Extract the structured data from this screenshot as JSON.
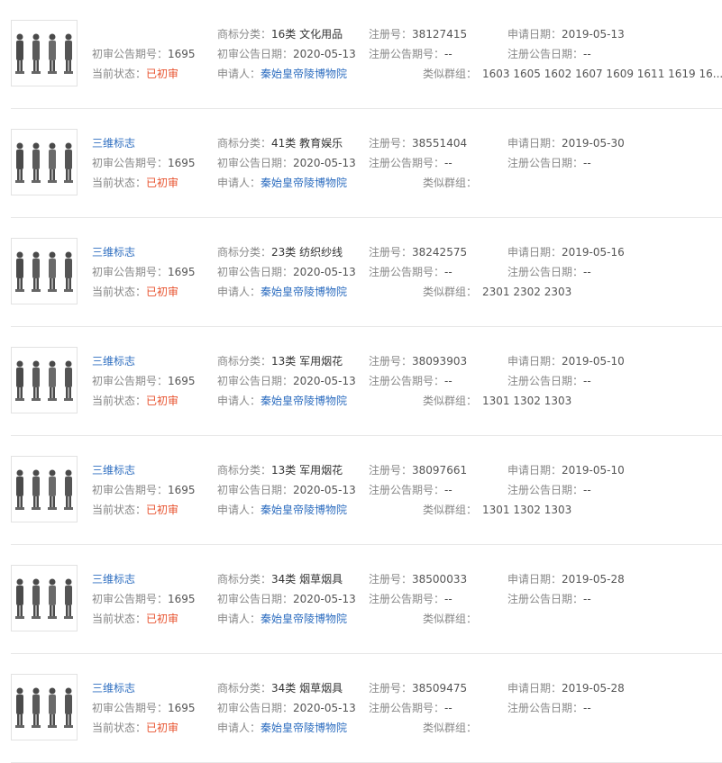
{
  "labels": {
    "announce_no": "初审公告期号：",
    "status": "当前状态：",
    "category": "商标分类：",
    "announce_date": "初审公告日期：",
    "applicant": "申请人：",
    "reg_no": "注册号：",
    "reg_announce_no": "注册公告期号：",
    "similar_group": "类似群组：",
    "apply_date": "申请日期：",
    "reg_announce_date": "注册公告日期："
  },
  "records": [
    {
      "title": "",
      "announce_no": "1695",
      "status": "已初审",
      "category": "16类 文化用品",
      "announce_date": "2020-05-13",
      "applicant": "秦始皇帝陵博物院",
      "reg_no": "38127415",
      "reg_announce_no": "--",
      "similar_group": "1603 1605 1602 1607 1609 1611 1619 16...",
      "apply_date": "2019-05-13",
      "reg_announce_date": "--"
    },
    {
      "title": "三维标志",
      "announce_no": "1695",
      "status": "已初审",
      "category": "41类 教育娱乐",
      "announce_date": "2020-05-13",
      "applicant": "秦始皇帝陵博物院",
      "reg_no": "38551404",
      "reg_announce_no": "--",
      "similar_group": "",
      "apply_date": "2019-05-30",
      "reg_announce_date": "--"
    },
    {
      "title": "三维标志",
      "announce_no": "1695",
      "status": "已初审",
      "category": "23类 纺织纱线",
      "announce_date": "2020-05-13",
      "applicant": "秦始皇帝陵博物院",
      "reg_no": "38242575",
      "reg_announce_no": "--",
      "similar_group": "2301 2302 2303",
      "apply_date": "2019-05-16",
      "reg_announce_date": "--"
    },
    {
      "title": "三维标志",
      "announce_no": "1695",
      "status": "已初审",
      "category": "13类 军用烟花",
      "announce_date": "2020-05-13",
      "applicant": "秦始皇帝陵博物院",
      "reg_no": "38093903",
      "reg_announce_no": "--",
      "similar_group": "1301 1302 1303",
      "apply_date": "2019-05-10",
      "reg_announce_date": "--"
    },
    {
      "title": "三维标志",
      "announce_no": "1695",
      "status": "已初审",
      "category": "13类 军用烟花",
      "announce_date": "2020-05-13",
      "applicant": "秦始皇帝陵博物院",
      "reg_no": "38097661",
      "reg_announce_no": "--",
      "similar_group": "1301 1302 1303",
      "apply_date": "2019-05-10",
      "reg_announce_date": "--"
    },
    {
      "title": "三维标志",
      "announce_no": "1695",
      "status": "已初审",
      "category": "34类 烟草烟具",
      "announce_date": "2020-05-13",
      "applicant": "秦始皇帝陵博物院",
      "reg_no": "38500033",
      "reg_announce_no": "--",
      "similar_group": "",
      "apply_date": "2019-05-28",
      "reg_announce_date": "--"
    },
    {
      "title": "三维标志",
      "announce_no": "1695",
      "status": "已初审",
      "category": "34类 烟草烟具",
      "announce_date": "2020-05-13",
      "applicant": "秦始皇帝陵博物院",
      "reg_no": "38509475",
      "reg_announce_no": "--",
      "similar_group": "",
      "apply_date": "2019-05-28",
      "reg_announce_date": "--"
    }
  ]
}
